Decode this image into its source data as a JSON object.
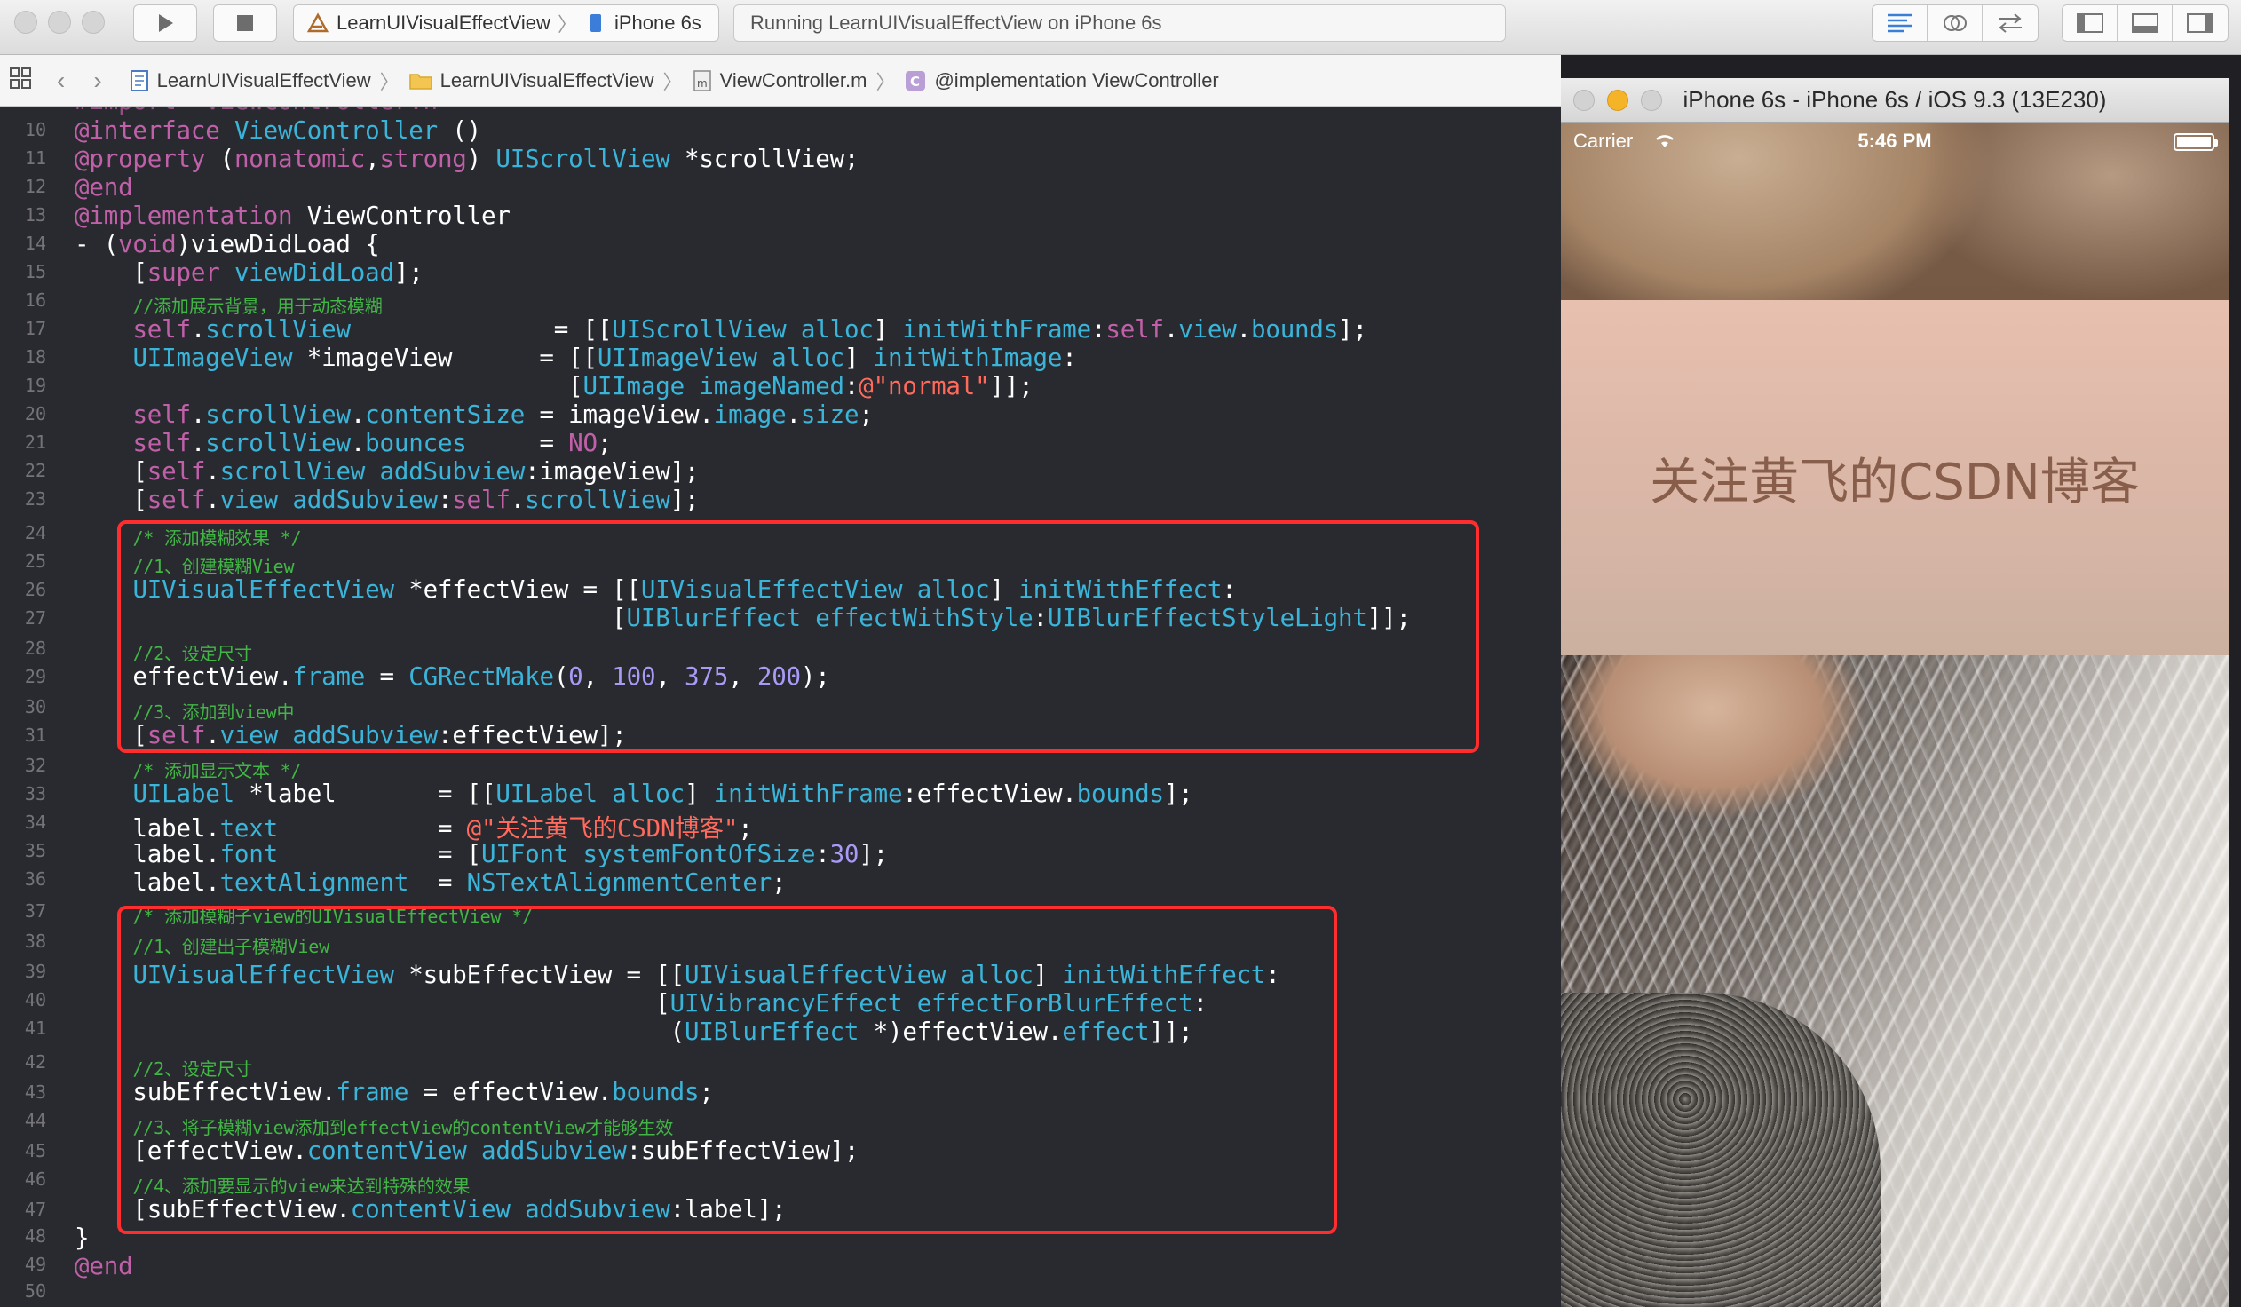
{
  "toolbar": {
    "scheme_target": "LearnUIVisualEffectView",
    "scheme_sep": "〉",
    "scheme_device": "iPhone 6s",
    "status_text": "Running LearnUIVisualEffectView on iPhone 6s"
  },
  "jumpbar": {
    "items": [
      "LearnUIVisualEffectView",
      "LearnUIVisualEffectView",
      "ViewController.m",
      "@implementation ViewController"
    ]
  },
  "editor": {
    "top_partial": "#import \"ViewController.h\"",
    "line_numbers": [
      "10",
      "11",
      "12",
      "13",
      "14",
      "15",
      "16",
      "17",
      "18",
      "19",
      "20",
      "21",
      "22",
      "23",
      "24",
      "25",
      "26",
      "27",
      "28",
      "29",
      "30",
      "31",
      "32",
      "33",
      "34",
      "35",
      "36",
      "37",
      "38",
      "39",
      "40",
      "41",
      "42",
      "43",
      "44",
      "45",
      "46",
      "47",
      "48",
      "49",
      "50"
    ],
    "comments": {
      "c16": "//添加展示背景，用于动态模糊",
      "c24": "/* 添加模糊效果 */",
      "c25": "//1、创建模糊View",
      "c28": "//2、设定尺寸",
      "c30": "//3、添加到view中",
      "c32": "/* 添加显示文本 */",
      "c37": "/* 添加模糊子view的UIVisualEffectView */",
      "c38": "//1、创建出子模糊View",
      "c42": "//2、设定尺寸",
      "c44": "//3、将子模糊view添加到effectView的contentView才能够生效",
      "c46": "//4、添加要显示的view来达到特殊的效果"
    },
    "strings": {
      "normal": "@\"normal\"",
      "label_text": "@\"关注黄飞的CSDN博客\""
    },
    "numbers": {
      "x": "0",
      "y": "100",
      "w": "375",
      "h": "200",
      "font": "30"
    }
  },
  "simulator": {
    "title": "iPhone 6s - iPhone 6s / iOS 9.3 (13E230)",
    "carrier": "Carrier",
    "time": "5:46 PM",
    "label": "关注黄飞的CSDN博客"
  },
  "colors": {
    "highlight_box": "#ff2d2d",
    "editor_bg": "#292a30",
    "keyword": "#c060a8",
    "class": "#3ab4d8",
    "comment": "#41b645",
    "number": "#a99af5",
    "string": "#ff6a5c"
  }
}
